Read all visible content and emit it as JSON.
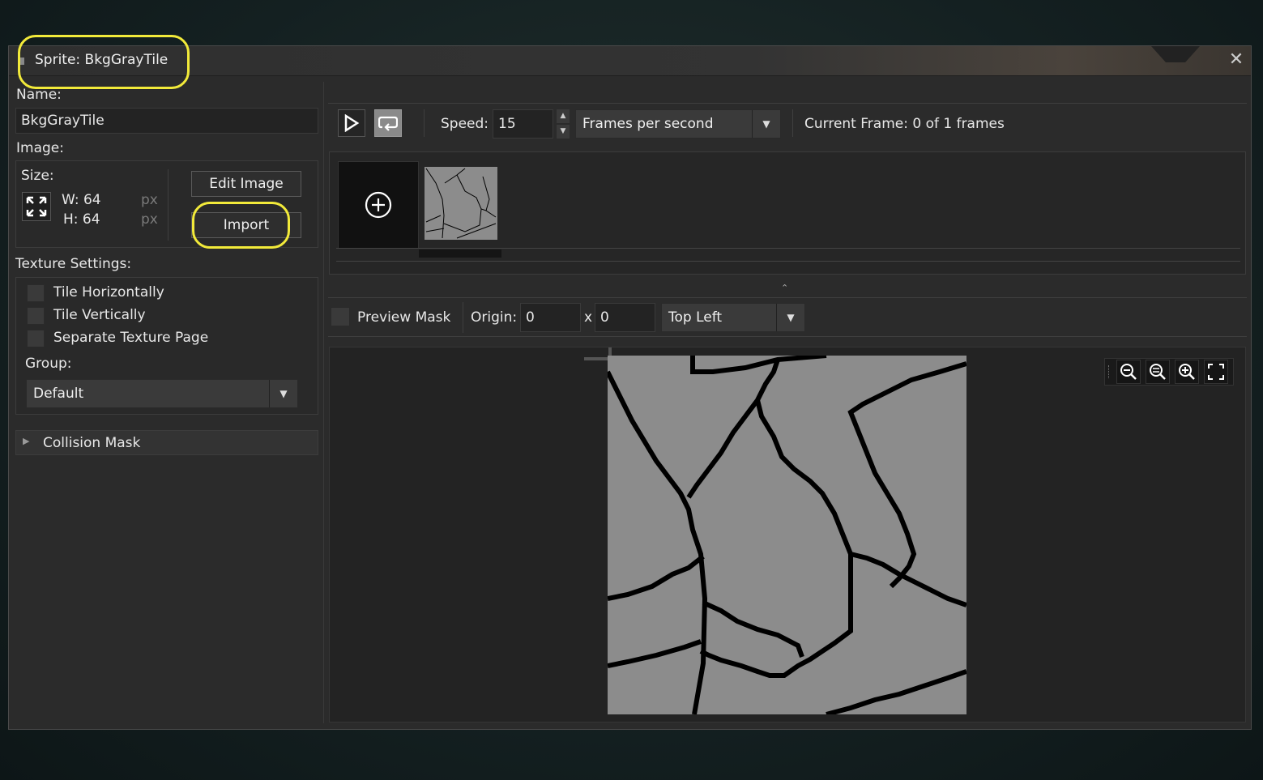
{
  "window": {
    "title": "Sprite: BkgGrayTile",
    "close_icon": "close-icon"
  },
  "left": {
    "name_label": "Name:",
    "name_value": "BkgGrayTile",
    "image_label": "Image:",
    "size_label": "Size:",
    "width_text": "W: 64",
    "height_text": "H: 64",
    "px_unit_1": "px",
    "px_unit_2": "px",
    "edit_image_label": "Edit Image",
    "import_label": "Import",
    "texture_settings_label": "Texture Settings:",
    "tile_h_label": "Tile Horizontally",
    "tile_v_label": "Tile Vertically",
    "separate_page_label": "Separate Texture Page",
    "group_label": "Group:",
    "group_value": "Default",
    "collision_mask_label": "Collision Mask"
  },
  "toolbar": {
    "speed_label": "Speed:",
    "speed_value": "15",
    "speed_unit": "Frames per second",
    "current_frame_label": "Current Frame: 0 of 1 frames"
  },
  "mask_bar": {
    "preview_mask_label": "Preview Mask",
    "origin_label": "Origin:",
    "origin_x": "0",
    "x_sep": "x",
    "origin_y": "0",
    "origin_preset": "Top Left"
  },
  "colors": {
    "highlight": "#f2ea3a",
    "sprite_gray": "#8c8c8c",
    "crack_line": "#000000"
  }
}
